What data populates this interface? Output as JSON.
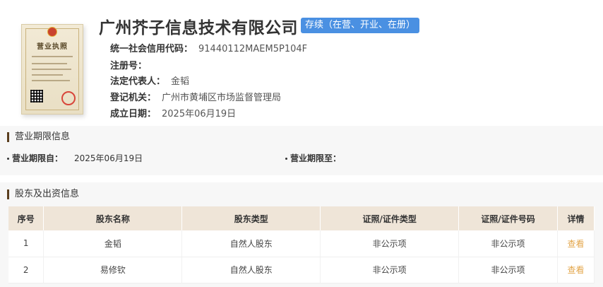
{
  "company": {
    "name": "广州芥子信息技术有限公司",
    "status": "存续（在营、开业、在册）"
  },
  "license_image": {
    "title": "营业执照"
  },
  "info": [
    {
      "label": "统一社会信用代码：",
      "value": "91440112MAEM5P104F"
    },
    {
      "label": "注册号：",
      "value": ""
    },
    {
      "label": "法定代表人：",
      "value": "金韬"
    },
    {
      "label": "登记机关：",
      "value": "广州市黄埔区市场监督管理局"
    },
    {
      "label": "成立日期：",
      "value": "2025年06月19日"
    }
  ],
  "business_period": {
    "title": "营业期限信息",
    "from_label": "营业期限自：",
    "from_value": "2025年06月19日",
    "to_label": "营业期限至：",
    "to_value": ""
  },
  "shareholders": {
    "title": "股东及出资信息",
    "headers": [
      "序号",
      "股东名称",
      "股东类型",
      "证照/证件类型",
      "证照/证件号码",
      "详情"
    ],
    "rows": [
      [
        "1",
        "金韬",
        "自然人股东",
        "非公示项",
        "非公示项",
        "查看"
      ],
      [
        "2",
        "易修钦",
        "自然人股东",
        "非公示项",
        "非公示项",
        "查看"
      ]
    ]
  },
  "colors": {
    "badge": "#4a90e2",
    "link": "#e3a64a",
    "table_header": "#efe5d8",
    "section_bar": "#5a3e1e"
  }
}
